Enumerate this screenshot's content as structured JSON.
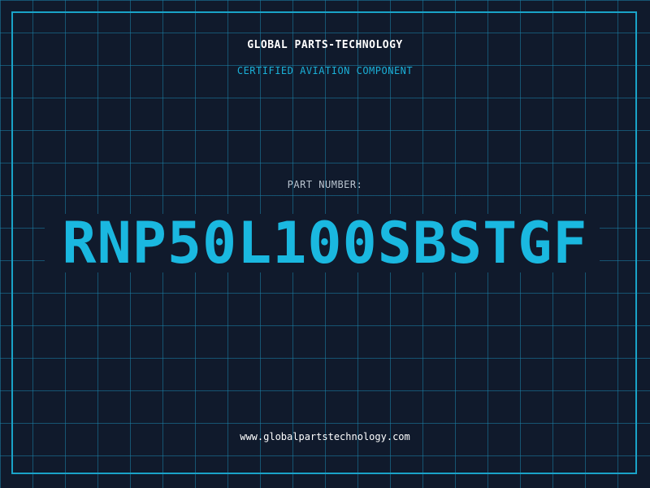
{
  "header": {
    "company": "GLOBAL PARTS-TECHNOLOGY",
    "tagline": "CERTIFIED AVIATION COMPONENT"
  },
  "part": {
    "label": "PART NUMBER:",
    "number": "RNP50L100SBSTGF"
  },
  "footer": {
    "website": "www.globalpartstechnology.com"
  },
  "colors": {
    "background": "#101a2c",
    "grid": "#1c82aa",
    "accent": "#1ab8e0",
    "text": "#ffffff"
  }
}
